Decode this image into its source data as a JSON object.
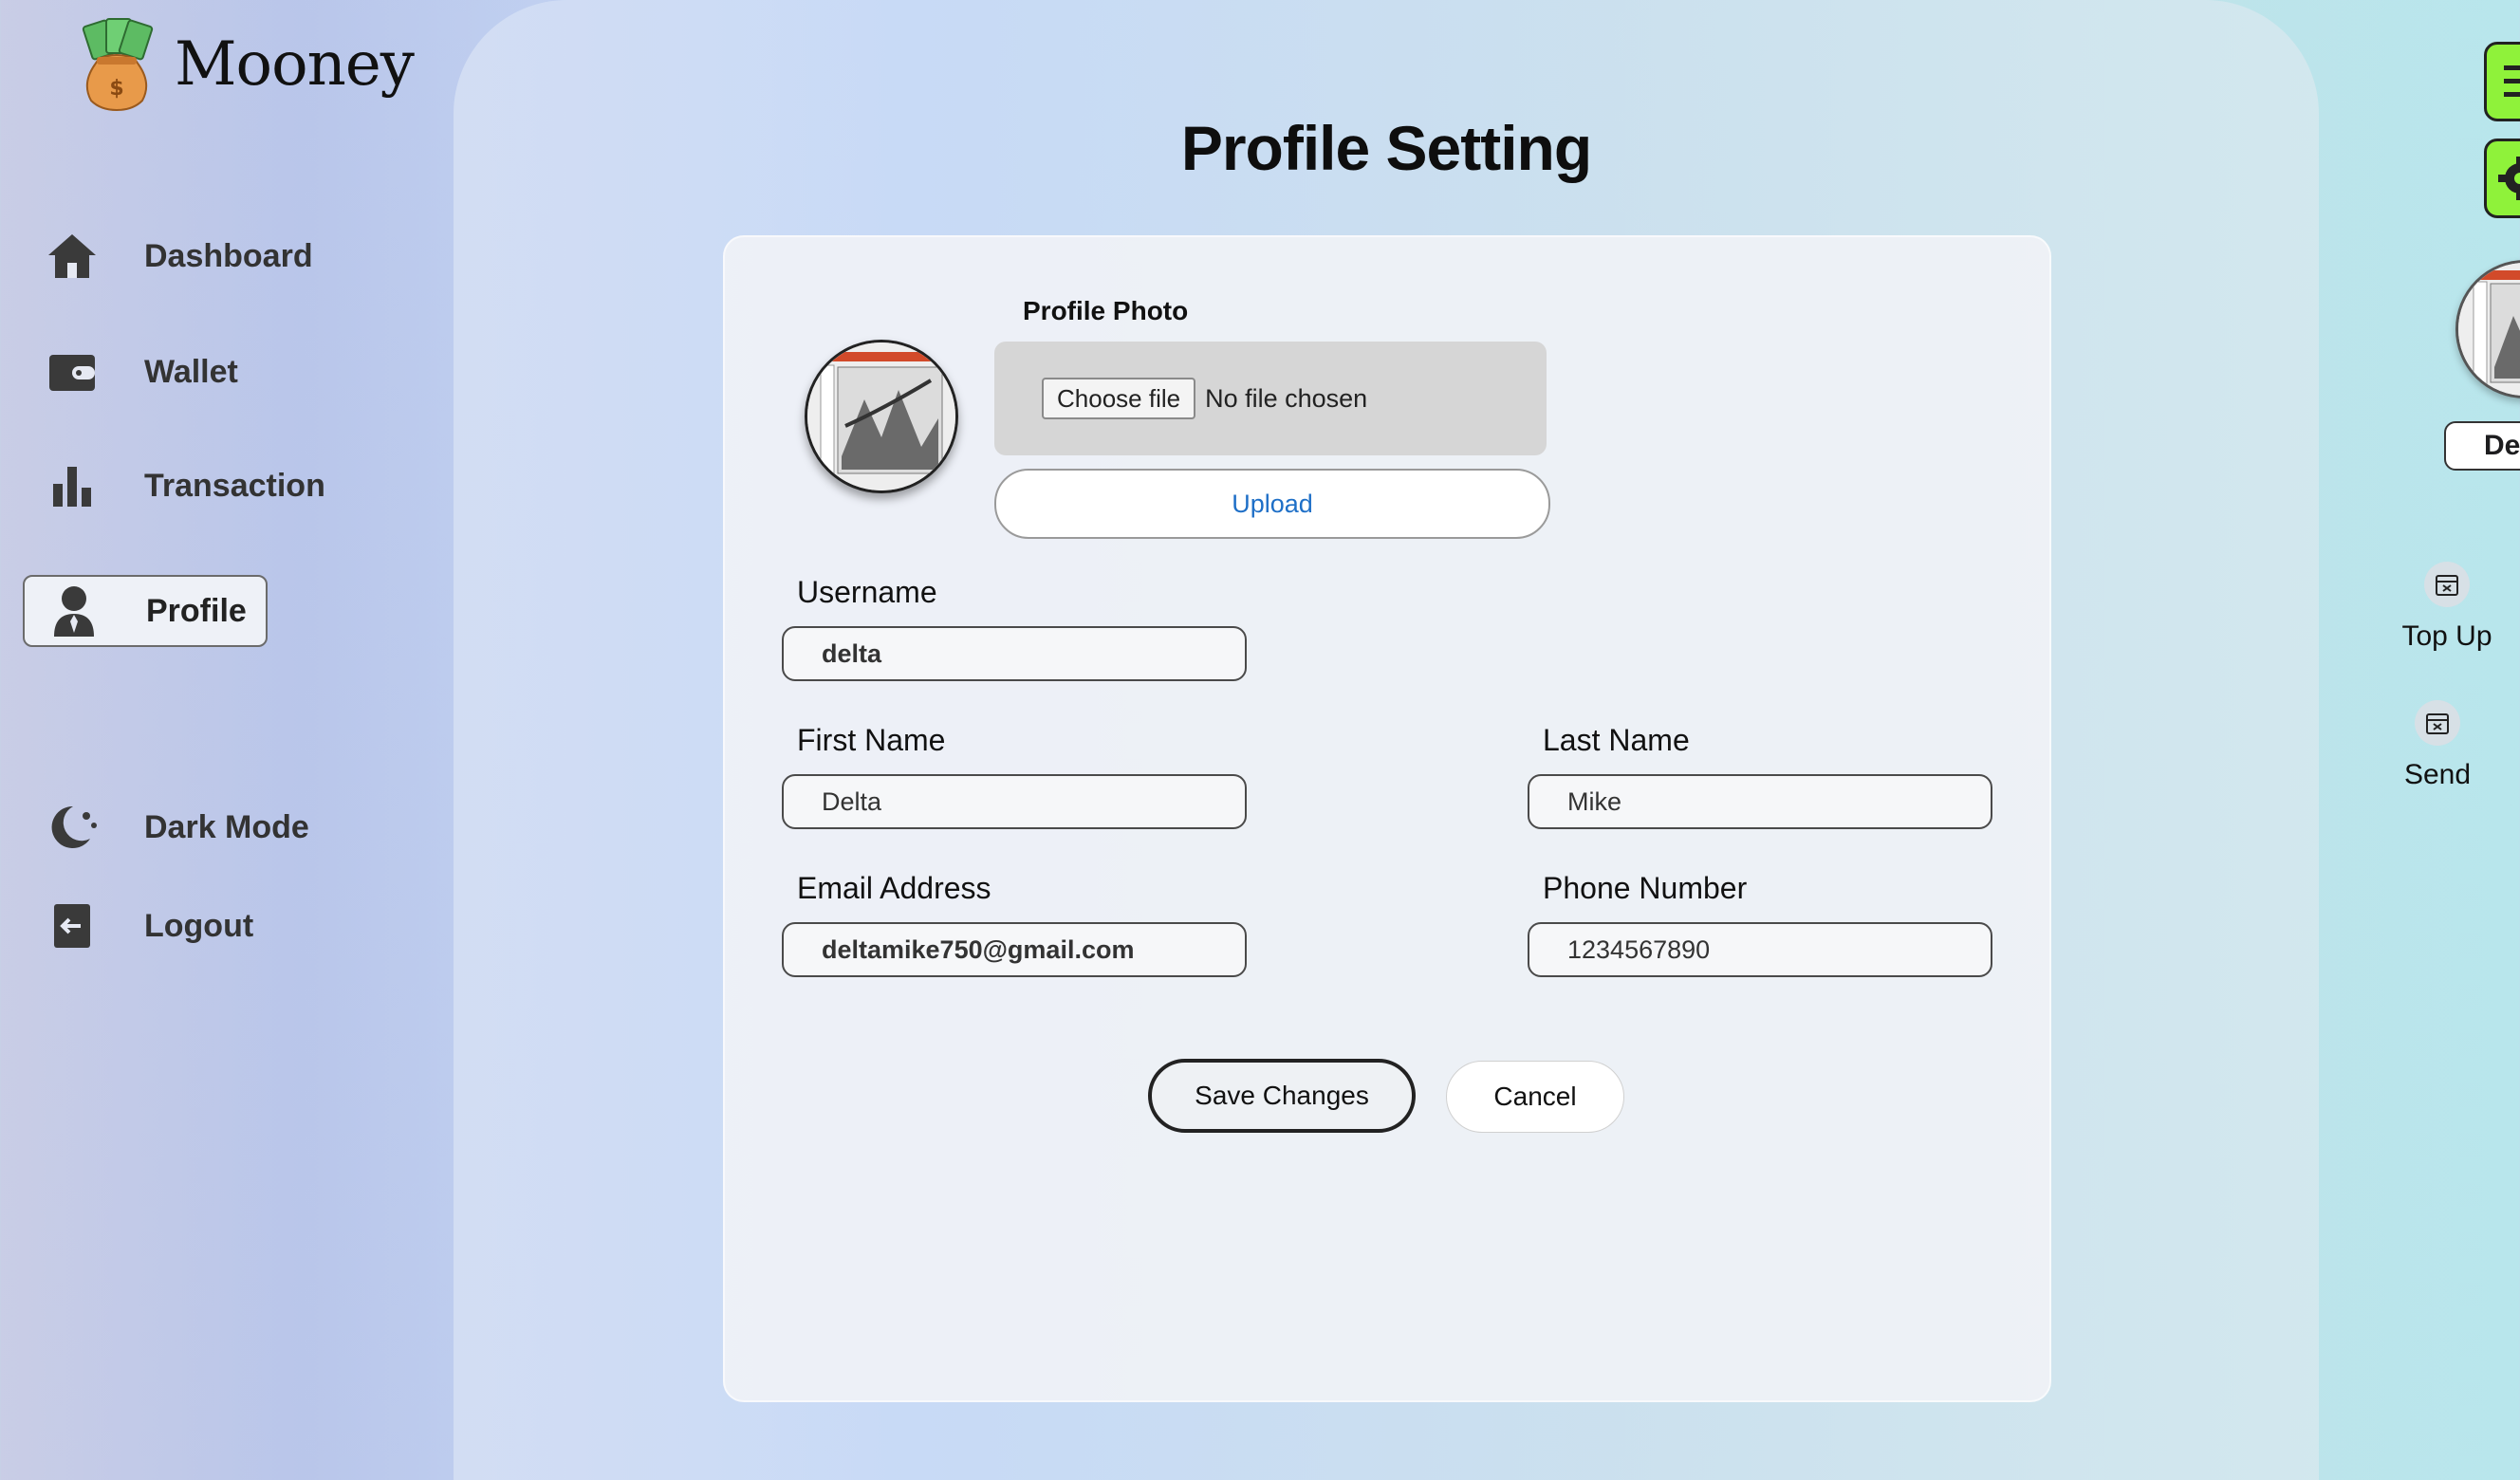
{
  "app": {
    "name": "Mooney"
  },
  "sidebar": {
    "items": [
      {
        "label": "Dashboard",
        "icon": "home-icon"
      },
      {
        "label": "Wallet",
        "icon": "wallet-icon"
      },
      {
        "label": "Transaction",
        "icon": "bar-chart-icon"
      },
      {
        "label": "Profile",
        "icon": "user-icon",
        "active": true
      },
      {
        "label": "Dark Mode",
        "icon": "moon-icon"
      },
      {
        "label": "Logout",
        "icon": "logout-icon"
      }
    ]
  },
  "page": {
    "title": "Profile Setting"
  },
  "profile_photo": {
    "label": "Profile Photo",
    "choose_file_label": "Choose file",
    "file_status": "No file chosen",
    "upload_label": "Upload"
  },
  "form": {
    "username": {
      "label": "Username",
      "value": "delta"
    },
    "first_name": {
      "label": "First Name",
      "value": "Delta"
    },
    "last_name": {
      "label": "Last Name",
      "value": "Mike"
    },
    "email": {
      "label": "Email Address",
      "value": "deltamike750@gmail.com"
    },
    "phone": {
      "label": "Phone Number",
      "value": "1234567890"
    }
  },
  "actions": {
    "save_label": "Save Changes",
    "cancel_label": "Cancel"
  },
  "right_panel": {
    "user_name": "De",
    "quick_actions": [
      {
        "label": "Top Up"
      },
      {
        "label": "Send"
      }
    ]
  },
  "colors": {
    "accent": "#8ff23a",
    "link": "#1e6fc7"
  }
}
